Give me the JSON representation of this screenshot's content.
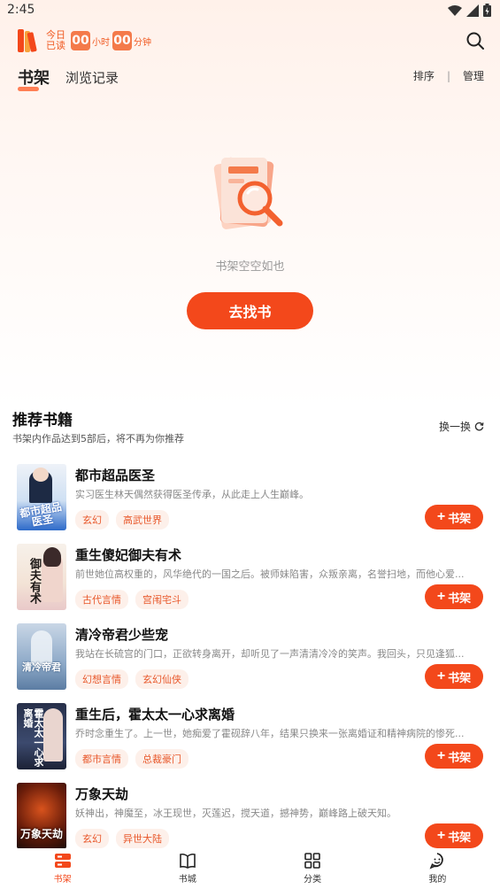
{
  "status_bar": {
    "time": "2:45"
  },
  "header": {
    "today_read_label": "今日已读",
    "hours_value": "00",
    "hours_unit": "小时",
    "minutes_value": "00",
    "minutes_unit": "分钟"
  },
  "tabs": {
    "bookshelf": "书架",
    "history": "浏览记录",
    "sort": "排序",
    "separator": "|",
    "manage": "管理"
  },
  "empty_state": {
    "message": "书架空空如也",
    "button": "去找书"
  },
  "recommend": {
    "title": "推荐书籍",
    "subtitle": "书架内作品达到5部后，将不再为你推荐",
    "refresh_label": "换一换",
    "add_label": "书架",
    "books": [
      {
        "title": "都市超品医圣",
        "desc": "实习医生林天偶然获得医圣传承，从此走上人生巅峰。",
        "tags": [
          "玄幻",
          "高武世界"
        ],
        "cover_text": "都市超品医圣"
      },
      {
        "title": "重生傻妃御夫有术",
        "desc": "前世她位高权重的，风华绝代的一国之后。被师妹陷害，众叛亲离，名誉扫地，而他心爱...",
        "tags": [
          "古代言情",
          "宫闱宅斗"
        ],
        "cover_text": "御夫有术"
      },
      {
        "title": "清冷帝君少些宠",
        "desc": "我站在长硫宫的门口，正欲转身离开，却听见了一声清清冷冷的笑声。我回头，只见逢狐...",
        "tags": [
          "幻想言情",
          "玄幻仙侠"
        ],
        "cover_text": "清冷帝君"
      },
      {
        "title": "重生后，霍太太一心求离婚",
        "desc": "乔时念重生了。上一世，她痴爱了霍砚辞八年，结果只换来一张离婚证和精神病院的惨死...",
        "tags": [
          "都市言情",
          "总裁豪门"
        ],
        "cover_text": "霍太太一心求离婚"
      },
      {
        "title": "万象天劫",
        "desc": "妖神出，神魔至，冰王现世，灭莲迟，搅天道，撼神势，巅峰路上破天知。",
        "tags": [
          "玄幻",
          "异世大陆"
        ],
        "cover_text": "万象天劫"
      }
    ]
  },
  "bottom_nav": {
    "items": [
      {
        "label": "书架",
        "icon": "bookshelf-icon"
      },
      {
        "label": "书城",
        "icon": "book-open-icon"
      },
      {
        "label": "分类",
        "icon": "grid-icon"
      },
      {
        "label": "我的",
        "icon": "profile-icon"
      }
    ]
  },
  "colors": {
    "accent": "#f3481b",
    "tag_text": "#e8572a",
    "tag_bg": "#fdf0ea"
  }
}
